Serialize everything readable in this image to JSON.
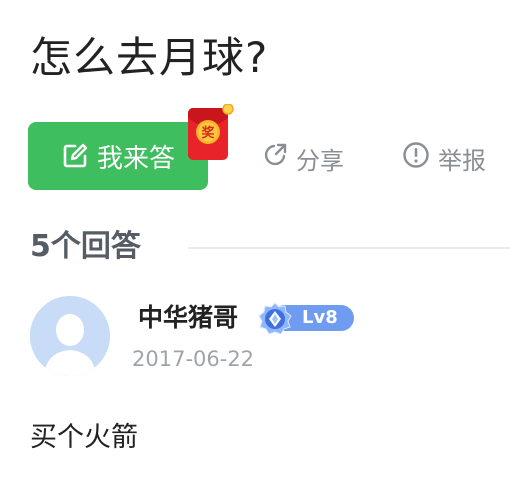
{
  "question": {
    "title": "怎么去月球?"
  },
  "actions": {
    "answer_label": "我来答",
    "redpacket_text": "奖",
    "share_label": "分享",
    "report_label": "举报"
  },
  "answers": {
    "count_label": "5个回答",
    "items": [
      {
        "author": "中华猪哥",
        "level": "Lv8",
        "date": "2017-06-22",
        "content": "买个火箭"
      }
    ]
  },
  "colors": {
    "primary_green": "#3fbe5f",
    "redpacket": "#e8232a",
    "level_blue": "#6f9cf1",
    "muted_gray": "#8a8f96"
  },
  "icons": {
    "answer": "edit-icon",
    "share": "share-icon",
    "report": "report-icon",
    "level": "gem-icon"
  }
}
